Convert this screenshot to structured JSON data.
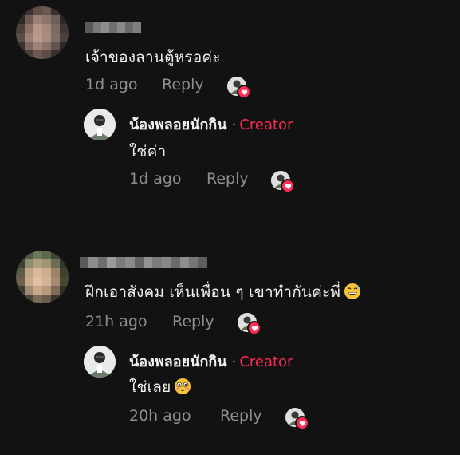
{
  "comments": [
    {
      "text": "เจ้าของลานตู้หรอค่ะ",
      "time": "1d ago",
      "reply_label": "Reply",
      "reply": {
        "author": "น้องพลอยนักกิน",
        "separator": "·",
        "badge": "Creator",
        "text": "ใช่ค่า",
        "time": "1d ago",
        "reply_label": "Reply"
      }
    },
    {
      "text": "ฝึกเอาสังคม เห็นเพื่อน ๆ เขาทำกันค่ะพี่",
      "emoji": "grinning-sweat-emoji",
      "time": "21h ago",
      "reply_label": "Reply",
      "reply": {
        "author": "น้องพลอยนักกิน",
        "separator": "·",
        "badge": "Creator",
        "text": "ใช่เลย",
        "emoji": "flushed-face-emoji",
        "time": "20h ago",
        "reply_label": "Reply"
      }
    }
  ],
  "colors": {
    "background": "#121212",
    "creator_badge": "#fe2c55",
    "meta_text": "#8e8e8e",
    "body_text": "#f2f2f2"
  }
}
